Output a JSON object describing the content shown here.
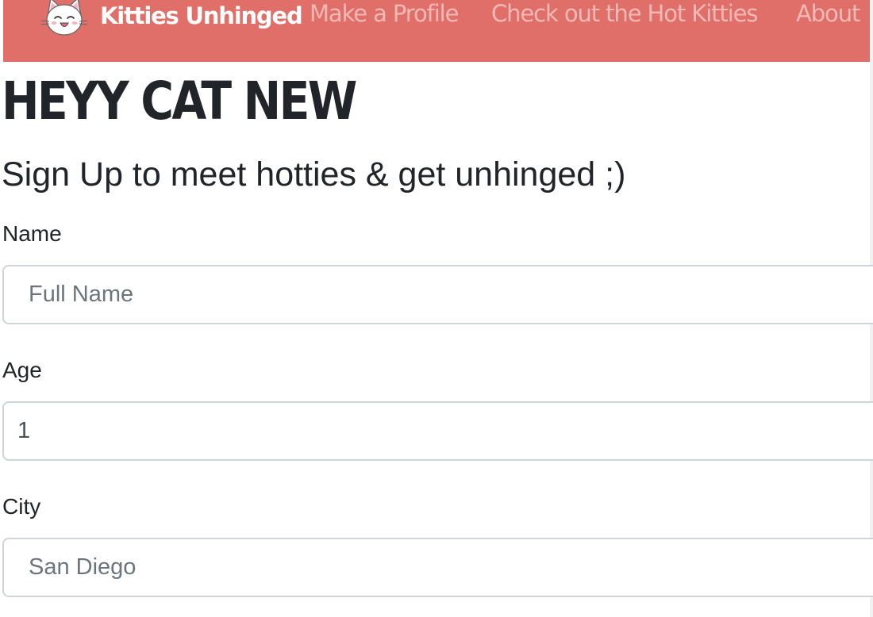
{
  "navbar": {
    "brand": "Kitties Unhinged",
    "links": [
      "Make a Profile",
      "Check out the Hot Kitties",
      "About"
    ],
    "bg_color": "#e06f69",
    "link_color": "#f6b9b5"
  },
  "page": {
    "heading": "HEYY CAT NEW",
    "subheading": "Sign Up to meet hotties & get unhinged ;)"
  },
  "form": {
    "name": {
      "label": "Name",
      "placeholder": "Full Name",
      "value": ""
    },
    "age": {
      "label": "Age",
      "value": "1"
    },
    "city": {
      "label": "City",
      "placeholder": "San Diego",
      "value": ""
    }
  },
  "icons": {
    "brand_logo": "cat-face-icon"
  }
}
